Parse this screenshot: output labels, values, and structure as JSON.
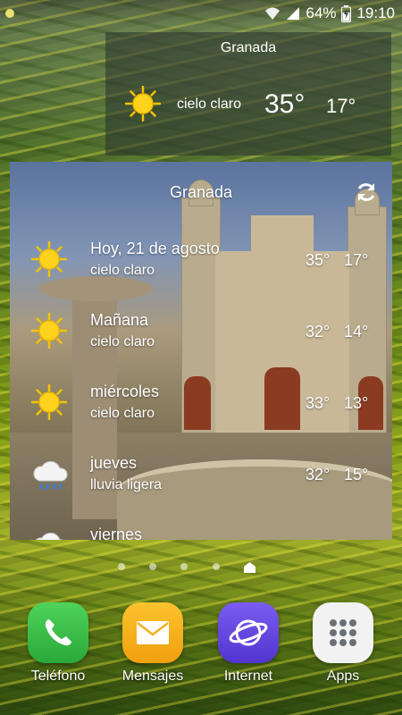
{
  "status_bar": {
    "battery": "64%",
    "time": "19:10"
  },
  "small_widget": {
    "city": "Granada",
    "condition": "cielo claro",
    "high": "35°",
    "low": "17°",
    "icon": "sun-icon"
  },
  "forecast_widget": {
    "city": "Granada",
    "days": [
      {
        "name": "Hoy, 21 de agosto",
        "condition": "cielo claro",
        "high": "35°",
        "low": "17°",
        "icon": "sun-icon"
      },
      {
        "name": "Mañana",
        "condition": "cielo claro",
        "high": "32°",
        "low": "14°",
        "icon": "sun-icon"
      },
      {
        "name": "miércoles",
        "condition": "cielo claro",
        "high": "33°",
        "low": "13°",
        "icon": "sun-icon"
      },
      {
        "name": "jueves",
        "condition": "lluvia ligera",
        "high": "32°",
        "low": "15°",
        "icon": "rain-cloud-icon"
      },
      {
        "name": "viernes",
        "condition": "",
        "high": "",
        "low": "",
        "icon": "cloud-icon"
      }
    ]
  },
  "page_indicator": {
    "count": 5,
    "active": 4
  },
  "dock": {
    "apps": [
      {
        "label": "Teléfono",
        "icon": "phone-icon",
        "color": "#3bc24a"
      },
      {
        "label": "Mensajes",
        "icon": "envelope-icon",
        "color": "#f6b21c"
      },
      {
        "label": "Internet",
        "icon": "planet-icon",
        "color": "#6b4de0"
      },
      {
        "label": "Apps",
        "icon": "apps-grid-icon",
        "color": "#f2f2f2"
      }
    ]
  }
}
